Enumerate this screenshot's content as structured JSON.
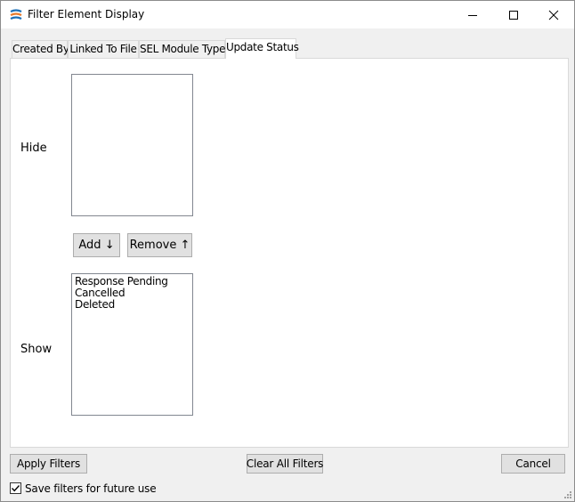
{
  "window": {
    "title": "Filter Element Display",
    "icon": "app-logo-icon",
    "controls": [
      "minimize-icon",
      "maximize-icon",
      "close-icon"
    ]
  },
  "tabs": [
    {
      "label": "Created By",
      "active": false
    },
    {
      "label": "Linked To File",
      "active": false
    },
    {
      "label": "SEL Module Type",
      "active": false
    },
    {
      "label": "Update Status",
      "active": true
    }
  ],
  "panel": {
    "hide_label": "Hide",
    "hide_items": [],
    "add_button": "Add ↓",
    "remove_button": "Remove ↑",
    "show_label": "Show",
    "show_items": [
      "Response Pending",
      "Cancelled",
      "Deleted"
    ]
  },
  "footer": {
    "apply_button": "Apply Filters",
    "clear_button": "Clear All Filters",
    "cancel_button": "Cancel",
    "save_checkbox_label": "Save filters for future use",
    "save_checkbox_checked": true
  },
  "colors": {
    "accent_blue": "#1c6fb8",
    "accent_orange": "#e8792a"
  }
}
